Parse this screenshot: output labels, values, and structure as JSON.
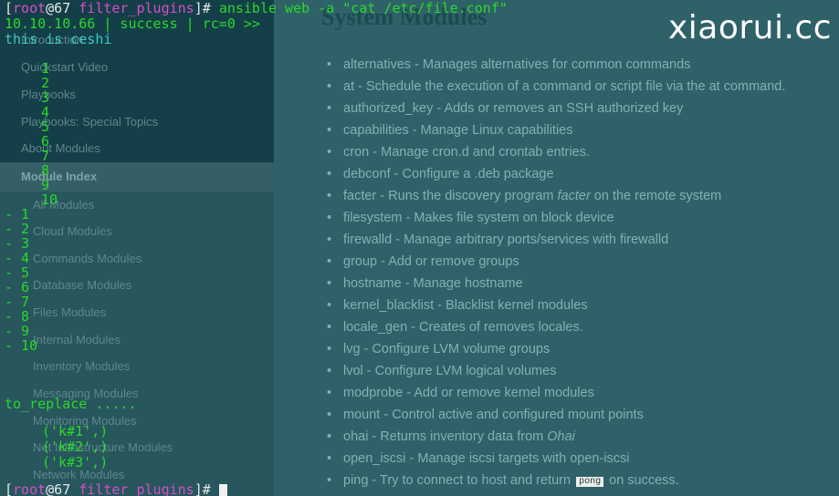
{
  "watermark": "xiaorui.cc",
  "docs": {
    "title": "System Modules",
    "sidebar": {
      "items": [
        {
          "label": "Introduction",
          "level": 1
        },
        {
          "label": "Quickstart Video",
          "level": 1
        },
        {
          "label": "Playbooks",
          "level": 1
        },
        {
          "label": "Playbooks: Special Topics",
          "level": 1
        },
        {
          "label": "About Modules",
          "level": 1
        },
        {
          "label": "Module Index",
          "level": 1,
          "active": true
        },
        {
          "label": "All Modules",
          "level": 2
        },
        {
          "label": "Cloud Modules",
          "level": 2
        },
        {
          "label": "Commands Modules",
          "level": 2
        },
        {
          "label": "Database Modules",
          "level": 2
        },
        {
          "label": "Files Modules",
          "level": 2
        },
        {
          "label": "Internal Modules",
          "level": 2
        },
        {
          "label": "Inventory Modules",
          "level": 2
        },
        {
          "label": "Messaging Modules",
          "level": 2
        },
        {
          "label": "Monitoring Modules",
          "level": 2
        },
        {
          "label": "Net Infrastructure Modules",
          "level": 2
        },
        {
          "label": "Network Modules",
          "level": 2
        }
      ]
    },
    "modules": [
      {
        "name": "alternatives",
        "desc": "Manages alternatives for common commands"
      },
      {
        "name": "at",
        "desc": "Schedule the execution of a command or script file via the at command."
      },
      {
        "name": "authorized_key",
        "desc": "Adds or removes an SSH authorized key"
      },
      {
        "name": "capabilities",
        "desc": "Manage Linux capabilities"
      },
      {
        "name": "cron",
        "desc": "Manage cron.d and crontab entries."
      },
      {
        "name": "debconf",
        "desc": "Configure a .deb package"
      },
      {
        "name": "facter",
        "desc_pre": "Runs the discovery program ",
        "desc_em": "facter",
        "desc_post": " on the remote system"
      },
      {
        "name": "filesystem",
        "desc": "Makes file system on block device"
      },
      {
        "name": "firewalld",
        "desc": "Manage arbitrary ports/services with firewalld"
      },
      {
        "name": "group",
        "desc": "Add or remove groups"
      },
      {
        "name": "hostname",
        "desc": "Manage hostname"
      },
      {
        "name": "kernel_blacklist",
        "desc": "Blacklist kernel modules"
      },
      {
        "name": "locale_gen",
        "desc": "Creates of removes locales."
      },
      {
        "name": "lvg",
        "desc": "Configure LVM volume groups"
      },
      {
        "name": "lvol",
        "desc": "Configure LVM logical volumes"
      },
      {
        "name": "modprobe",
        "desc": "Add or remove kernel modules"
      },
      {
        "name": "mount",
        "desc": "Control active and configured mount points"
      },
      {
        "name": "ohai",
        "desc_pre": "Returns inventory data from ",
        "desc_em": "Ohai",
        "desc_post": ""
      },
      {
        "name": "open_iscsi",
        "desc": "Manage iscsi targets with open-iscsi"
      },
      {
        "name": "ping",
        "desc_pre": "Try to connect to host and return ",
        "desc_code": "pong",
        "desc_post": " on success."
      }
    ]
  },
  "terminal": {
    "prompt": {
      "open": "[",
      "user": "root",
      "at": "@67",
      "dir": "filter_plugins",
      "close": "]#"
    },
    "command": "ansible web -a \"cat /etc/file.conf\"",
    "result_header": "10.10.10.66 | success | rc=0 >>",
    "first_line": "this is ceshi",
    "numbers": [
      "1",
      "2",
      "3",
      "4",
      "5",
      "6",
      "7",
      "8",
      "9",
      "10"
    ],
    "dashed": [
      "- 1",
      "- 2",
      "- 3",
      "- 4",
      "- 5",
      "- 6",
      "- 7",
      "- 8",
      "- 9",
      "- 10"
    ],
    "to_replace": "to_replace .....",
    "tuples": [
      "('k#1',)",
      "('k#2',)",
      "('k#3',)"
    ]
  }
}
